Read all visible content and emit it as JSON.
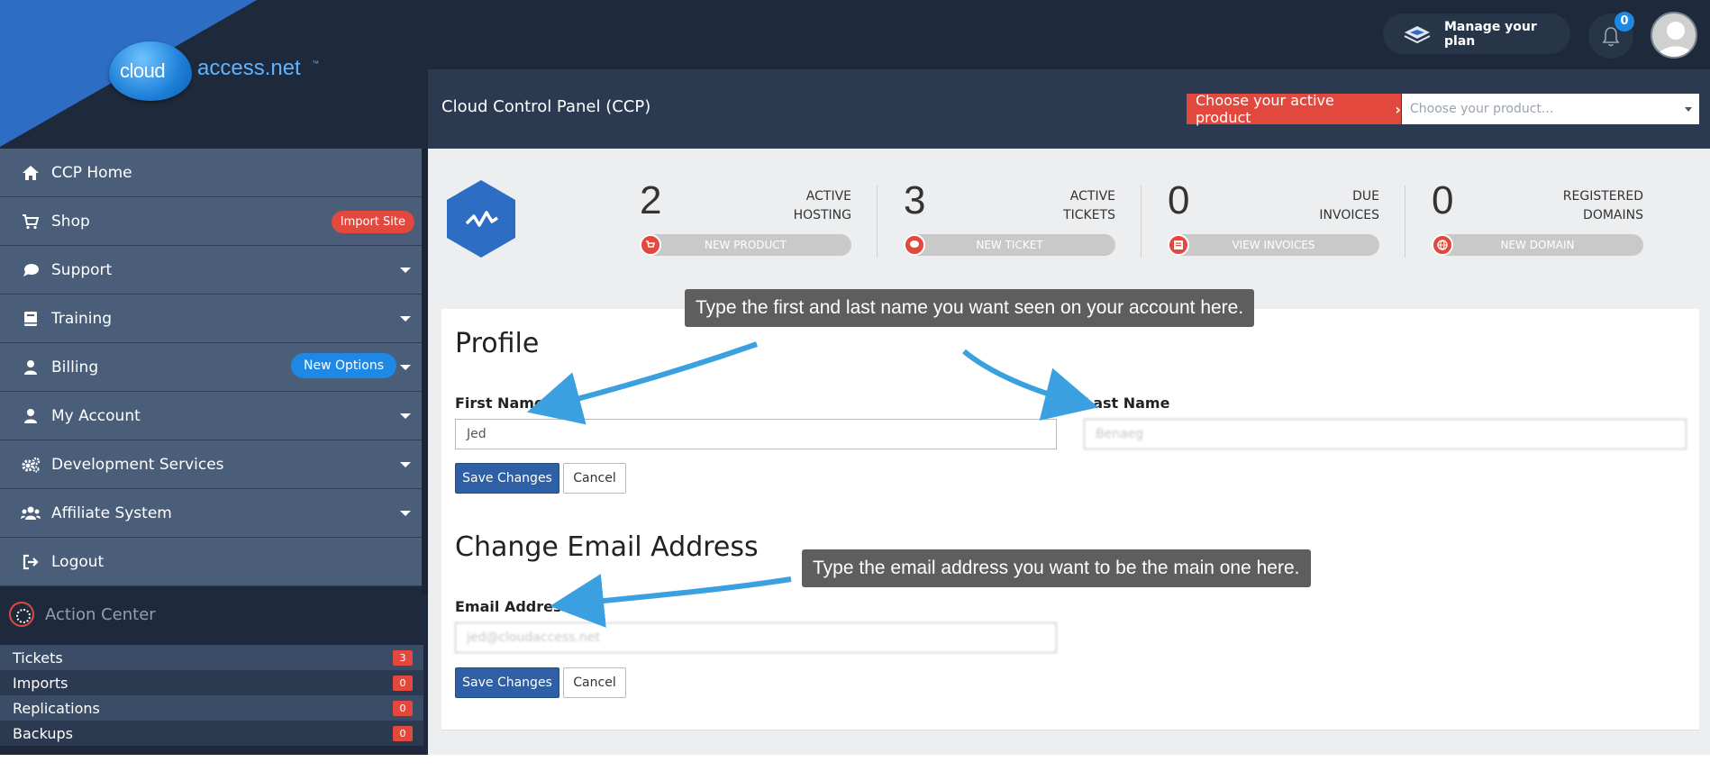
{
  "brand": {
    "logo_bubble_text": "cloud",
    "logo_text": "access.net",
    "logo_tm": "™"
  },
  "topbar": {
    "manage_plan_label": "Manage your plan",
    "notification_count": "0"
  },
  "header": {
    "page_title": "Cloud Control Panel (CCP)",
    "choose_product_label": "Choose your active product",
    "product_select_placeholder": "Choose your product..."
  },
  "sidebar": {
    "items": [
      {
        "label": "CCP Home",
        "icon": "home-icon"
      },
      {
        "label": "Shop",
        "icon": "cart-icon",
        "badge": "Import Site"
      },
      {
        "label": "Support",
        "icon": "chat-icon"
      },
      {
        "label": "Training",
        "icon": "book-icon"
      },
      {
        "label": "Billing",
        "icon": "user-icon",
        "badge": "New Options"
      },
      {
        "label": "My Account",
        "icon": "user-icon"
      },
      {
        "label": "Development Services",
        "icon": "gears-icon"
      },
      {
        "label": "Affiliate System",
        "icon": "users-icon"
      },
      {
        "label": "Logout",
        "icon": "logout-icon"
      }
    ],
    "action_center": {
      "title": "Action Center",
      "rows": [
        {
          "label": "Tickets",
          "count": "3"
        },
        {
          "label": "Imports",
          "count": "0"
        },
        {
          "label": "Replications",
          "count": "0"
        },
        {
          "label": "Backups",
          "count": "0"
        }
      ]
    }
  },
  "stats": [
    {
      "value": "2",
      "label_line1": "Active",
      "label_line2": "Hosting",
      "action": "New Product",
      "icon": "cart-icon"
    },
    {
      "value": "3",
      "label_line1": "Active",
      "label_line2": "Tickets",
      "action": "New Ticket",
      "icon": "chat-icon"
    },
    {
      "value": "0",
      "label_line1": "Due",
      "label_line2": "Invoices",
      "action": "View Invoices",
      "icon": "list-icon"
    },
    {
      "value": "0",
      "label_line1": "Registered",
      "label_line2": "Domains",
      "action": "New Domain",
      "icon": "globe-icon"
    }
  ],
  "profile": {
    "heading": "Profile",
    "first_name_label": "First Name",
    "first_name_value": "Jed",
    "last_name_label": "Last Name",
    "last_name_value": "Benaeg",
    "save_label": "Save Changes",
    "cancel_label": "Cancel"
  },
  "email": {
    "heading": "Change Email Address",
    "email_label": "Email Address",
    "email_value": "jed@cloudaccess.net",
    "save_label": "Save Changes",
    "cancel_label": "Cancel"
  },
  "annotations": {
    "name_tooltip": "Type the first and last name you want seen on your account here.",
    "email_tooltip": "Type the email address you want to be the main one here."
  },
  "colors": {
    "sidebar_bg": "#1e2a3b",
    "nav_item_bg": "#4a5e7a",
    "accent_red": "#e2483d",
    "accent_blue": "#1e88e5",
    "save_button": "#2f5fa5"
  }
}
